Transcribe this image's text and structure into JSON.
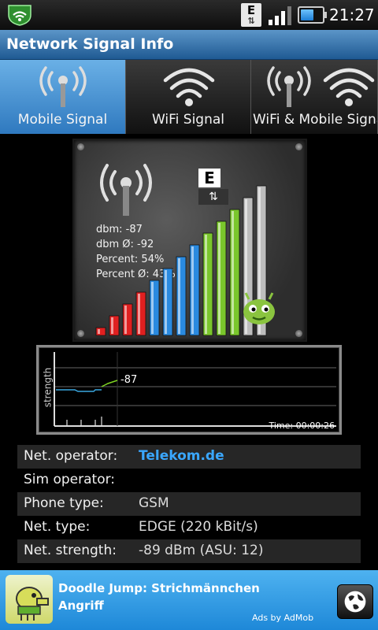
{
  "status_bar": {
    "clock": "21:27",
    "network_badge": "E",
    "icons": [
      "app-shield-icon",
      "edge-data-icon",
      "signal-bars-icon",
      "battery-icon"
    ],
    "battery_level": 0.6
  },
  "app": {
    "title": "Network Signal Info"
  },
  "tabs": [
    {
      "label": "Mobile Signal",
      "icon": "antenna-icon",
      "active": true
    },
    {
      "label": "WiFi Signal",
      "icon": "wifi-icon",
      "active": false
    },
    {
      "label": "WiFi & Mobile Signal",
      "icon": "antenna-wifi-icon",
      "active": false
    }
  ],
  "signal_panel": {
    "network_badge": "E",
    "dbm": "dbm: -87",
    "dbm_avg": "dbm Ø: -92",
    "percent": "Percent: 54%",
    "percent_avg": "Percent Ø: 43%",
    "strength_percent": 54,
    "colors": {
      "red": "#e02020",
      "blue": "#2a8ae0",
      "green": "#7ac62c",
      "inactive": "#bdbdbd"
    }
  },
  "graph": {
    "ylabel": "strength",
    "current_value": "-87",
    "time": "Time: 00:00:26",
    "colors": {
      "line_blue": "#3aa7e0",
      "line_green": "#7ed321"
    }
  },
  "info": {
    "rows": [
      {
        "key": "Net. operator:",
        "value": "Telekom.de",
        "link": true
      },
      {
        "key": "Sim operator:",
        "value": "",
        "link": false
      },
      {
        "key": "Phone type:",
        "value": "GSM",
        "link": false
      },
      {
        "key": "Net. type:",
        "value": "EDGE (220 kBit/s)",
        "link": false
      },
      {
        "key": "Net. strength:",
        "value": "-89 dBm (ASU: 12)",
        "link": false
      }
    ]
  },
  "ad": {
    "title_line1": "Doodle Jump: Strichmännchen",
    "title_line2": "Angriff",
    "attribution": "Ads by AdMob",
    "button_icon": "globe-icon"
  }
}
